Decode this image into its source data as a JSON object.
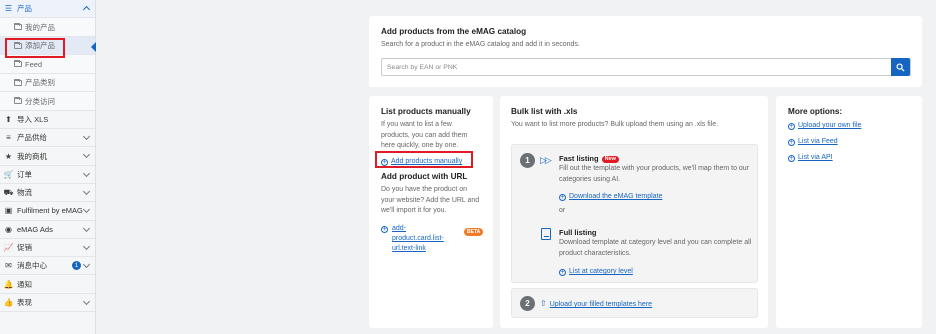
{
  "sidebar": {
    "products_label": "产品",
    "sub_items": [
      "我的产品",
      "添加产品",
      "Feed",
      "产品类别",
      "分类访问"
    ],
    "items": [
      {
        "label": "导入 XLS",
        "icon": "upload-icon",
        "glyph": "⬆",
        "chev": false
      },
      {
        "label": "产品供给",
        "icon": "stack-icon",
        "glyph": "≡",
        "chev": true
      },
      {
        "label": "我的商机",
        "icon": "star-icon",
        "glyph": "★",
        "chev": true
      },
      {
        "label": "订单",
        "icon": "cart-icon",
        "glyph": "🛒",
        "chev": true
      },
      {
        "label": "物流",
        "icon": "truck-icon",
        "glyph": "⛟",
        "chev": true
      },
      {
        "label": "Fulfilment by eMAG",
        "icon": "box-icon",
        "glyph": "▣",
        "chev": true
      },
      {
        "label": "eMAG Ads",
        "icon": "ads-icon",
        "glyph": "◉",
        "chev": true
      },
      {
        "label": "促销",
        "icon": "chart-icon",
        "glyph": "📈",
        "chev": true
      },
      {
        "label": "消息中心",
        "icon": "mail-icon",
        "glyph": "✉",
        "chev": true,
        "badge": "1"
      },
      {
        "label": "通知",
        "icon": "bell-icon",
        "glyph": "🔔",
        "chev": false
      },
      {
        "label": "表现",
        "icon": "thumb-icon",
        "glyph": "👍",
        "chev": true
      }
    ]
  },
  "catalog": {
    "title": "Add products from the eMAG catalog",
    "subtitle": "Search for a product in the eMAG catalog and add it in seconds.",
    "search_placeholder": "Search by EAN or PNK"
  },
  "manual": {
    "title": "List products manually",
    "desc": "If you want to list a few products, you can add them here quickly, one by one.",
    "add_link": "Add products manually",
    "url_title": "Add product with URL",
    "url_desc": "Do you have the product on your website? Add the URL and we'll import it for you.",
    "url_link": "add-product.card.list-url.text-link",
    "beta": "BETA"
  },
  "bulk": {
    "title": "Bulk list with .xls",
    "subtitle": "You want to list more products? Bulk upload them using an .xls file.",
    "step1": "1",
    "fast_title": "Fast listing",
    "new_badge": "New",
    "fast_desc": "Fill out the template with your products, we'll map them to our categories using AI.",
    "download_link": "Download the eMAG template",
    "or": "or",
    "full_title": "Full listing",
    "full_desc": "Download template at category level and you can complete all product characteristics.",
    "category_link": "List at category level",
    "step2": "2",
    "upload_link": "Upload your filled templates here"
  },
  "more": {
    "title": "More options:",
    "links": [
      "Upload your own file",
      "List via Feed",
      "List via API"
    ]
  },
  "colors": {
    "accent": "#1665c1",
    "highlight": "#e01b24",
    "beta": "#ef7b27"
  }
}
